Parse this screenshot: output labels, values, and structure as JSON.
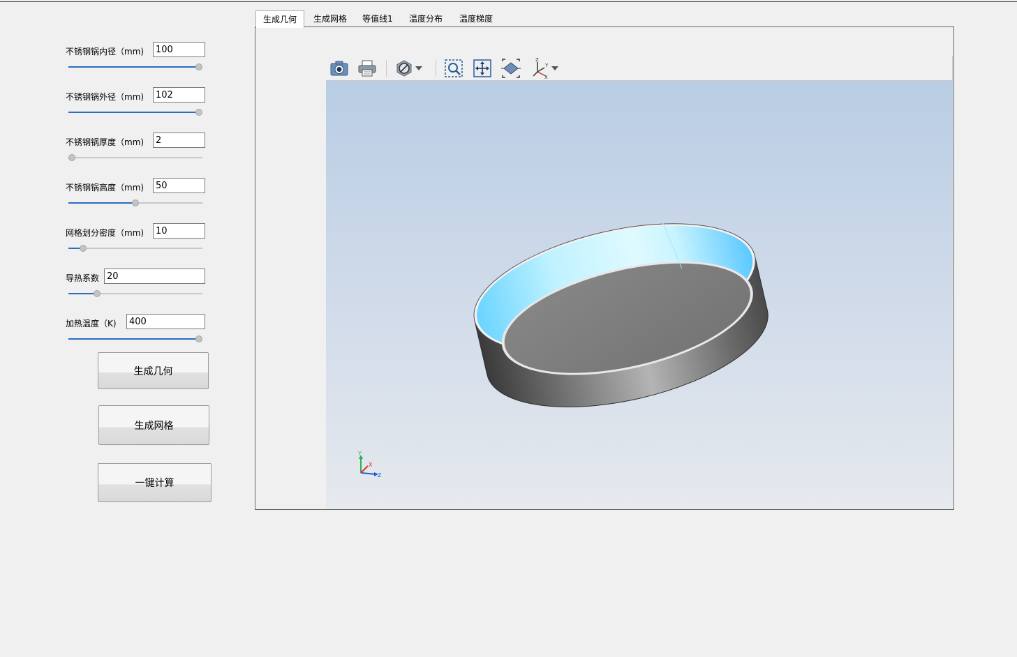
{
  "tabs": [
    "生成几何",
    "生成网格",
    "等值线1",
    "温度分布",
    "温度梯度"
  ],
  "params": [
    {
      "label": "不锈钢锅内径（mm)",
      "value": "100",
      "slider_fraction": 1.0
    },
    {
      "label": "不锈钢锅外径（mm)",
      "value": "102",
      "slider_fraction": 1.0
    },
    {
      "label": "不锈钢锅厚度（mm)",
      "value": "2",
      "slider_fraction": 0.0
    },
    {
      "label": "不锈钢锅高度（mm)",
      "value": "50",
      "slider_fraction": 0.5
    },
    {
      "label": "网格划分密度（mm)",
      "value": "10",
      "slider_fraction": 0.09
    },
    {
      "label": "导热系数",
      "value": "20",
      "slider_fraction": 0.2
    },
    {
      "label": "加热温度（K)",
      "value": "400",
      "slider_fraction": 1.0
    }
  ],
  "buttons": {
    "generate_geometry": "生成几何",
    "generate_mesh": "生成网格",
    "one_click_compute": "一键计算"
  },
  "toolbar": {
    "icons": [
      "camera-icon",
      "print-icon",
      "hide-icon",
      "dropdown-arrow-icon",
      "zoom-box-icon",
      "pan-icon",
      "fit-all-icon",
      "axes-icon",
      "dropdown-arrow-icon"
    ]
  },
  "axes_triad": {
    "x": "X",
    "y": "Y",
    "z": "Z"
  },
  "colors": {
    "inner_wall": "#7fdcff",
    "outer_wall": "#8a8a8a",
    "bottom": "#7d7d7d",
    "slider_fill": "#2b6ec0"
  }
}
